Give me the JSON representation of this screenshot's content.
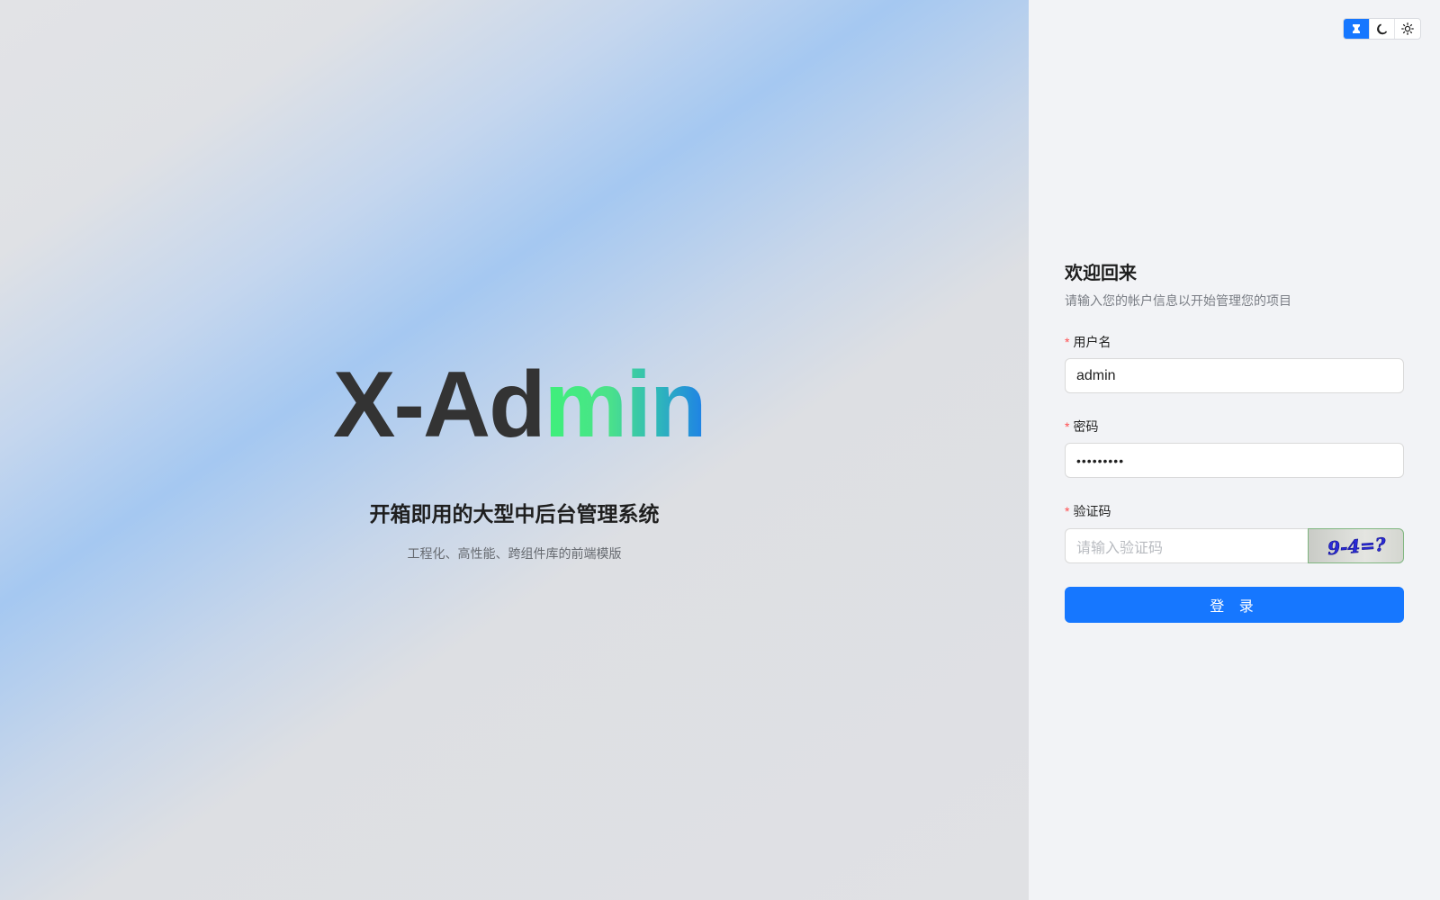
{
  "hero": {
    "logo_dark": "X-Ad",
    "logo_gradient": "min",
    "title": "开箱即用的大型中后台管理系统",
    "subtitle": "工程化、高性能、跨组件库的前端模版"
  },
  "theme_switch": {
    "options": [
      "system-icon",
      "moon-icon",
      "sun-icon"
    ],
    "active": "system-icon",
    "accent": "#1677ff"
  },
  "login": {
    "heading": "欢迎回来",
    "subheading": "请输入您的帐户信息以开始管理您的项目",
    "username_label": "用户名",
    "username_value": "admin",
    "password_label": "密码",
    "password_value": "•••••••••",
    "captcha_label": "验证码",
    "captcha_placeholder": "请输入验证码",
    "captcha_text": "9-4=?",
    "required_mark": "*",
    "submit_label": "登 录"
  }
}
